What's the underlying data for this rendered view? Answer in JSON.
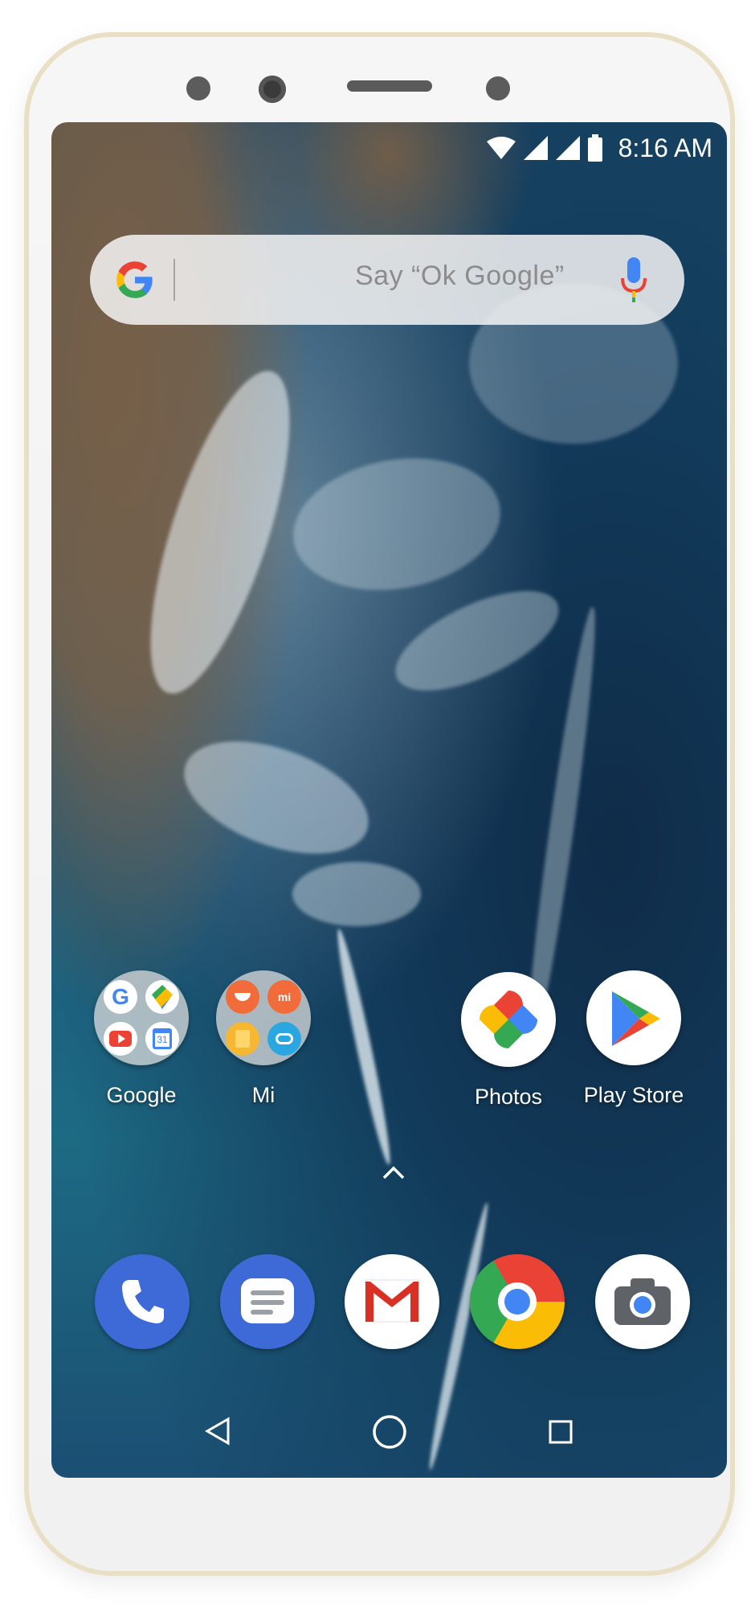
{
  "status_bar": {
    "time": "8:16 AM",
    "icons": [
      "wifi-icon",
      "cell-signal-icon",
      "cell-signal-icon",
      "battery-icon"
    ]
  },
  "search_bar": {
    "hint": "Say “Ok Google”",
    "icons": [
      "google-g-icon",
      "microphone-icon"
    ]
  },
  "home_apps": [
    {
      "label": "Google",
      "icon": "google-folder-icon"
    },
    {
      "label": "Mi",
      "icon": "mi-folder-icon"
    },
    {
      "label": "Photos",
      "icon": "photos-icon"
    },
    {
      "label": "Play Store",
      "icon": "play-store-icon"
    }
  ],
  "app_drawer_hint": "chevron-up-icon",
  "dock": [
    {
      "icon": "phone-icon"
    },
    {
      "icon": "messages-icon"
    },
    {
      "icon": "gmail-icon"
    },
    {
      "icon": "chrome-icon"
    },
    {
      "icon": "camera-icon"
    }
  ],
  "nav_bar": [
    "back-icon",
    "home-icon",
    "recents-icon"
  ],
  "colors": {
    "phone_frame": "#e9dfc4",
    "google_blue": "#4285F4",
    "google_red": "#EA4335",
    "google_yellow": "#FBBC05",
    "google_green": "#34A853"
  }
}
